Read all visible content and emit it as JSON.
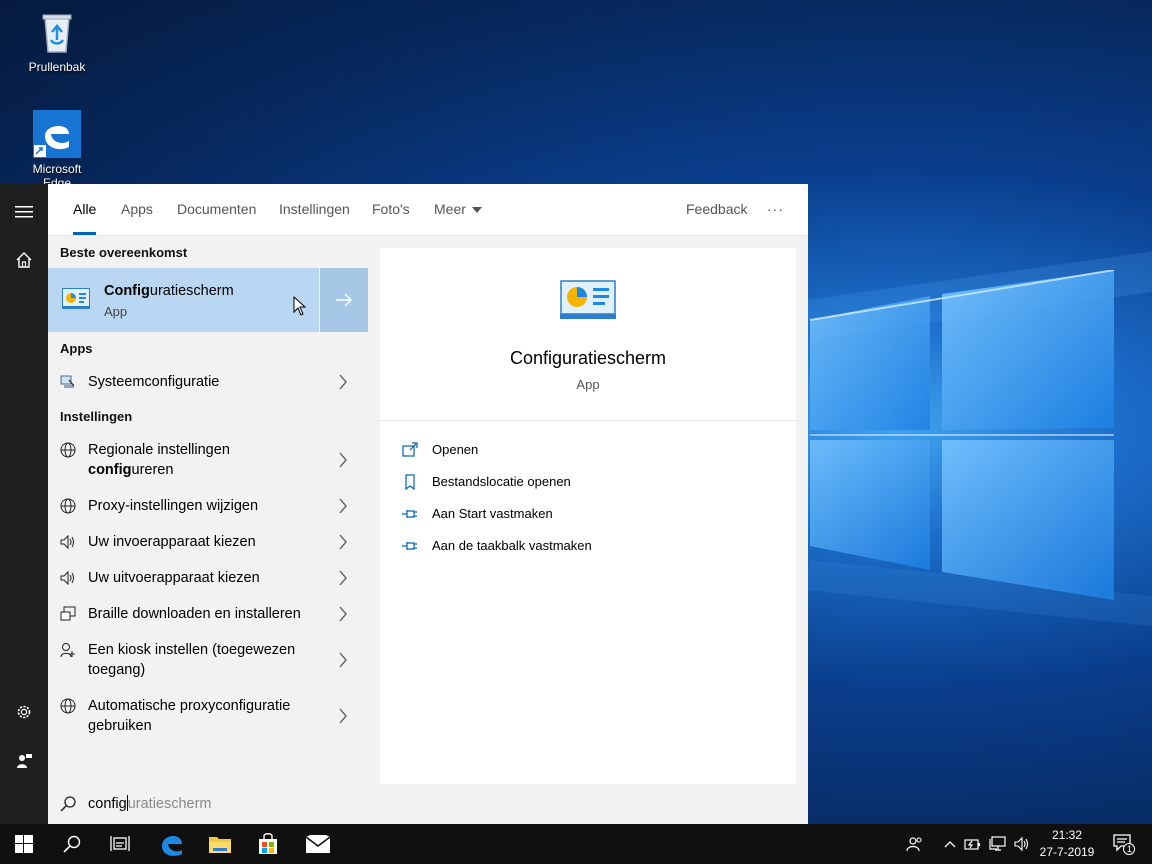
{
  "desktop": {
    "icons": [
      {
        "label": "Prullenbak",
        "icon": "recycle-bin-icon"
      },
      {
        "label": "Microsoft Edge",
        "icon": "edge-icon"
      }
    ]
  },
  "tabs": {
    "alle": "Alle",
    "apps": "Apps",
    "documenten": "Documenten",
    "instellingen": "Instellingen",
    "fotos": "Foto's",
    "meer": "Meer",
    "feedback": "Feedback",
    "more_options": "···"
  },
  "results": {
    "best_match_header": "Beste overeenkomst",
    "best_match": {
      "title_bold": "Config",
      "title_rest": "uratiescherm",
      "subtitle": "App"
    },
    "apps_header": "Apps",
    "apps": [
      {
        "label": "Systeemconfiguratie"
      }
    ],
    "settings_header": "Instellingen",
    "settings": [
      {
        "line1": "Regionale instellingen",
        "line2_bold": "config",
        "line2_rest": "ureren"
      },
      {
        "label": "Proxy-instellingen wijzigen"
      },
      {
        "label": "Uw invoerapparaat kiezen"
      },
      {
        "label": "Uw uitvoerapparaat kiezen"
      },
      {
        "label": "Braille downloaden en installeren"
      },
      {
        "line1": "Een kiosk instellen (toegewezen",
        "line2": "toegang)"
      },
      {
        "line1": "Automatische proxyconfiguratie",
        "line2": "gebruiken"
      }
    ]
  },
  "detail": {
    "title": "Configuratiescherm",
    "subtitle": "App",
    "actions": [
      {
        "label": "Openen",
        "icon": "open-icon"
      },
      {
        "label": "Bestandslocatie openen",
        "icon": "file-location-icon"
      },
      {
        "label": "Aan Start vastmaken",
        "icon": "pin-icon"
      },
      {
        "label": "Aan de taakbalk vastmaken",
        "icon": "pin-icon"
      }
    ]
  },
  "search": {
    "typed": "config",
    "suggestion": "uratiescherm"
  },
  "taskbar": {
    "time": "21:32",
    "date": "27-7-2019",
    "notification_count": "1"
  },
  "colors": {
    "accent": "#0063b1",
    "selected_bg": "#b9d7f2",
    "panel_bg": "#f2f2f2",
    "rail_bg": "#1f1f1f",
    "taskbar_bg": "#101010"
  }
}
